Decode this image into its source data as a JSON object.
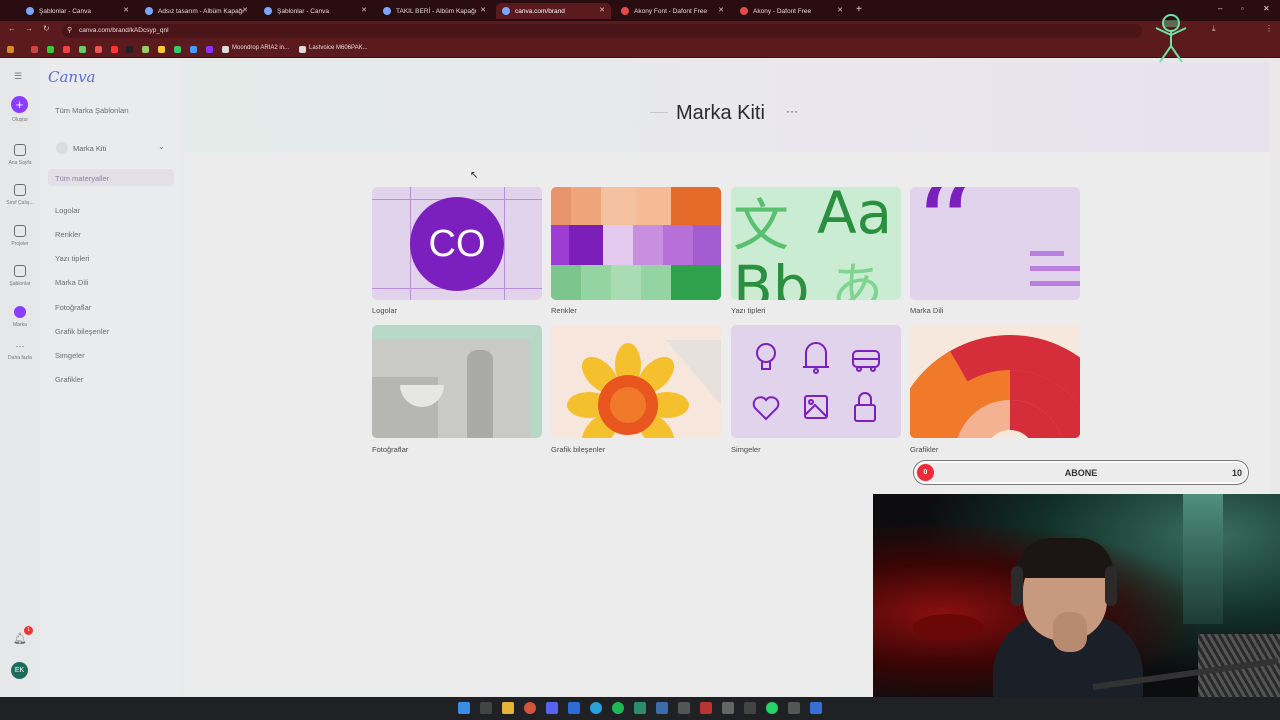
{
  "browser": {
    "tabs": [
      {
        "title": "Şablonlar - Canva",
        "active": false
      },
      {
        "title": "Adsız tasarım - Albüm Kapağı",
        "active": false
      },
      {
        "title": "Şablonlar - Canva",
        "active": false
      },
      {
        "title": "TAKIL BERİ - Albüm Kapağı",
        "active": false
      },
      {
        "title": "canva.com/brand",
        "active": true
      },
      {
        "title": "Akony Font - Dafont Free",
        "active": false
      },
      {
        "title": "Akony - Dafont Free",
        "active": false
      }
    ],
    "url": "canva.com/brand/kADcsyp_qnl",
    "bookmarks": [
      "Moondrop ARIA2 in...",
      "Lastvoice M606PAK..."
    ]
  },
  "rail": {
    "create_label": "Oluştur",
    "items": [
      "Ana Sayfa",
      "Sınıf Çalış...",
      "Projeler",
      "Şablonlar",
      "Marka",
      "Daha fazla"
    ],
    "notification_count": "1",
    "avatar_initials": "EK"
  },
  "sidebar": {
    "logo": "Canva",
    "all_brand_templates": "Tüm Marka Şablonları",
    "kit_select": "Marka Kiti",
    "items": [
      "Tüm materyaller",
      "Logolar",
      "Renkler",
      "Yazı tipleri",
      "Marka Dili",
      "Fotoğraflar",
      "Grafik bileşenler",
      "Simgeler",
      "Grafikler"
    ]
  },
  "main": {
    "title": "Marka Kiti",
    "more": "···",
    "cards": [
      {
        "label": "Logolar",
        "logo_text": "CO"
      },
      {
        "label": "Renkler"
      },
      {
        "label": "Yazı tipleri",
        "glyphs": [
          "文",
          "Aa",
          "Bb",
          "あ"
        ]
      },
      {
        "label": "Marka Dili",
        "glyph": "“"
      },
      {
        "label": "Fotoğraflar"
      },
      {
        "label": "Grafik bileşenler"
      },
      {
        "label": "Simgeler"
      },
      {
        "label": "Grafikler"
      }
    ]
  },
  "overlay": {
    "abone_label": "ABONE",
    "abone_left": "0",
    "abone_right": "10"
  }
}
